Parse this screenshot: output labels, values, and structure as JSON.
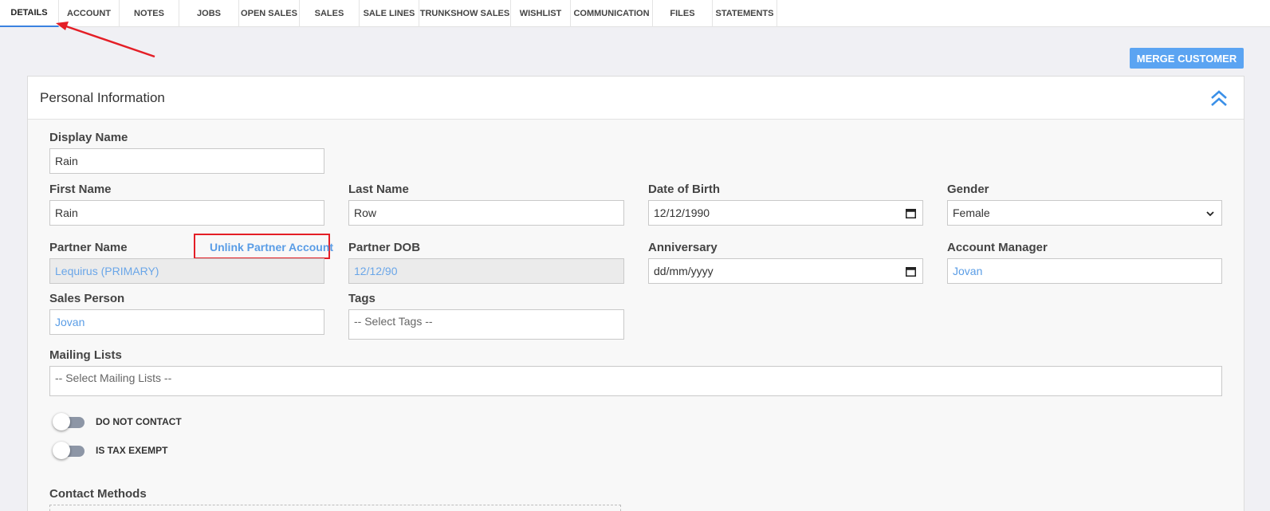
{
  "tabs": [
    {
      "label": "DETAILS",
      "active": true
    },
    {
      "label": "ACCOUNT"
    },
    {
      "label": "NOTES"
    },
    {
      "label": "JOBS"
    },
    {
      "label": "OPEN SALES"
    },
    {
      "label": "SALES"
    },
    {
      "label": "SALE LINES"
    },
    {
      "label": "TRUNKSHOW SALES"
    },
    {
      "label": "WISHLIST"
    },
    {
      "label": "COMMUNICATION"
    },
    {
      "label": "FILES"
    },
    {
      "label": "STATEMENTS"
    }
  ],
  "merge_button": "MERGE CUSTOMER",
  "panel": {
    "title": "Personal Information",
    "display_name": {
      "label": "Display Name",
      "value": "Rain"
    },
    "first_name": {
      "label": "First Name",
      "value": "Rain"
    },
    "last_name": {
      "label": "Last Name",
      "value": "Row"
    },
    "dob": {
      "label": "Date of Birth",
      "value": "12/12/1990"
    },
    "gender": {
      "label": "Gender",
      "value": "Female"
    },
    "partner_name": {
      "label": "Partner Name",
      "value": "Lequirus (PRIMARY)"
    },
    "unlink_partner": "Unlink Partner Account",
    "partner_dob": {
      "label": "Partner DOB",
      "value": "12/12/90"
    },
    "anniversary": {
      "label": "Anniversary",
      "placeholder": "dd/mm/yyyy"
    },
    "account_manager": {
      "label": "Account Manager",
      "value": "Jovan"
    },
    "sales_person": {
      "label": "Sales Person",
      "value": "Jovan"
    },
    "tags": {
      "label": "Tags",
      "placeholder": "-- Select Tags --"
    },
    "mailing_lists": {
      "label": "Mailing Lists",
      "placeholder": "-- Select Mailing Lists --"
    },
    "do_not_contact": {
      "label": "DO NOT CONTACT",
      "on": false
    },
    "tax_exempt": {
      "label": "IS TAX EXEMPT",
      "on": false
    },
    "contact_methods": {
      "label": "Contact Methods"
    }
  },
  "colors": {
    "accent": "#3a82e0",
    "button": "#5ba4f2",
    "link": "#5a9de6",
    "annotation": "#e41e26"
  }
}
